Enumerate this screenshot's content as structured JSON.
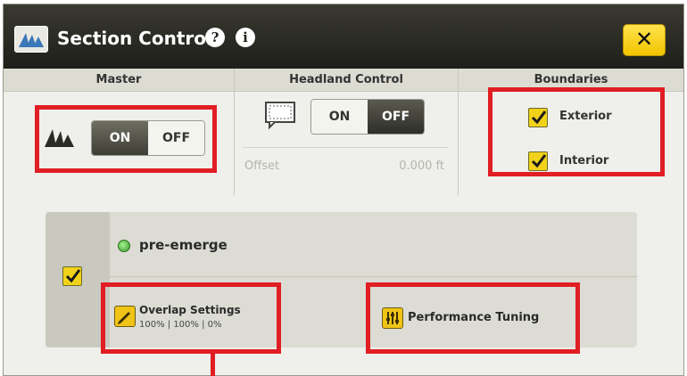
{
  "window": {
    "title": "Section Control",
    "help_icon_glyph": "?",
    "info_icon_glyph": "i",
    "close_label": "✕"
  },
  "columns": {
    "master": "Master",
    "headland": "Headland Control",
    "boundaries": "Boundaries"
  },
  "master": {
    "on_label": "ON",
    "off_label": "OFF",
    "selected": "ON"
  },
  "headland": {
    "on_label": "ON",
    "off_label": "OFF",
    "selected": "OFF",
    "offset_label": "Offset",
    "offset_value": "0.000 ft"
  },
  "boundaries": {
    "exterior_label": "Exterior",
    "exterior_checked": true,
    "interior_label": "Interior",
    "interior_checked": true
  },
  "product": {
    "name": "pre-emerge",
    "enabled": true,
    "status_color": "#3a9d2a"
  },
  "overlap": {
    "title": "Overlap Settings",
    "values": "100% | 100% | 0%"
  },
  "performance": {
    "label": "Performance Tuning"
  },
  "colors": {
    "accent": "#f1d21a",
    "highlight": "#e01e23",
    "titlebar": "#2b2b25"
  }
}
